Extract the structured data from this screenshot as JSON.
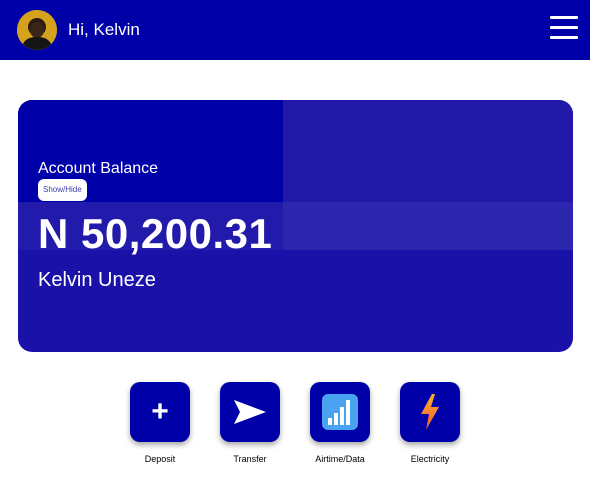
{
  "header": {
    "greeting": "Hi, Kelvin",
    "avatar_icon": "user-photo",
    "menu_icon": "hamburger-menu-icon"
  },
  "balance_card": {
    "label": "Account Balance",
    "toggle_label": "Show/Hide",
    "amount": "N 50,200.31",
    "account_name": "Kelvin Uneze"
  },
  "actions": [
    {
      "label": "Deposit",
      "icon": "plus-icon"
    },
    {
      "label": "Transfer",
      "icon": "send-arrow-icon"
    },
    {
      "label": "Airtime/Data",
      "icon": "signal-bars-icon"
    },
    {
      "label": "Electricity",
      "icon": "lightning-bolt-icon"
    }
  ],
  "colors": {
    "primary": "#0000a8",
    "card": "#1a12a8",
    "text_on_primary": "#ffffff"
  }
}
